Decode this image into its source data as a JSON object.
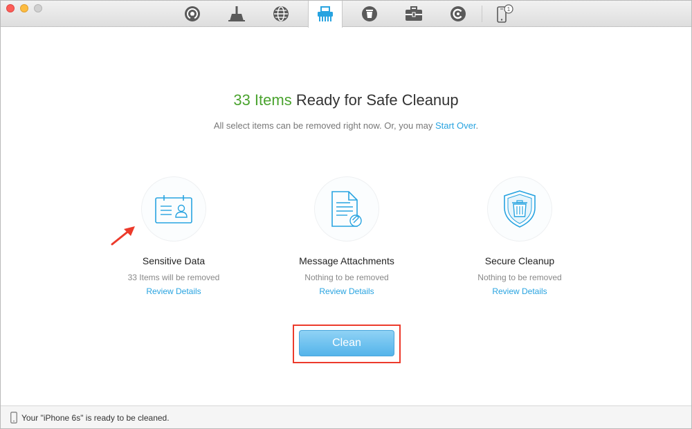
{
  "toolbar": {
    "tools": [
      {
        "name": "airbackup",
        "icon": "airplay-circle-icon"
      },
      {
        "name": "cleaner",
        "icon": "broom-icon"
      },
      {
        "name": "internet",
        "icon": "globe-icon"
      },
      {
        "name": "privacy",
        "icon": "shredder-icon",
        "active": true
      },
      {
        "name": "recycle",
        "icon": "recycle-bin-icon"
      },
      {
        "name": "toolbox",
        "icon": "toolbox-icon"
      },
      {
        "name": "backup",
        "icon": "backup-circle-icon"
      },
      {
        "name": "device",
        "icon": "iphone-icon",
        "badge": "1"
      }
    ]
  },
  "main": {
    "headline_count": "33 Items",
    "headline_rest": "Ready for Safe Cleanup",
    "subline_prefix": "All select items can be removed right now. Or, you may ",
    "subline_link": "Start Over",
    "subline_suffix": ".",
    "cards": [
      {
        "title": "Sensitive Data",
        "subtitle": "33 Items will be removed",
        "link": "Review Details",
        "icon": "id-card-icon"
      },
      {
        "title": "Message Attachments",
        "subtitle": "Nothing to be removed",
        "link": "Review Details",
        "icon": "document-attachment-icon"
      },
      {
        "title": "Secure Cleanup",
        "subtitle": "Nothing to be removed",
        "link": "Review Details",
        "icon": "shield-trash-icon"
      }
    ],
    "clean_label": "Clean"
  },
  "status": {
    "text": "Your \"iPhone 6s\" is ready to be cleaned."
  },
  "colors": {
    "accent_blue": "#27a3e0",
    "count_green": "#4aa32e",
    "highlight_red": "#ec3a2b"
  }
}
